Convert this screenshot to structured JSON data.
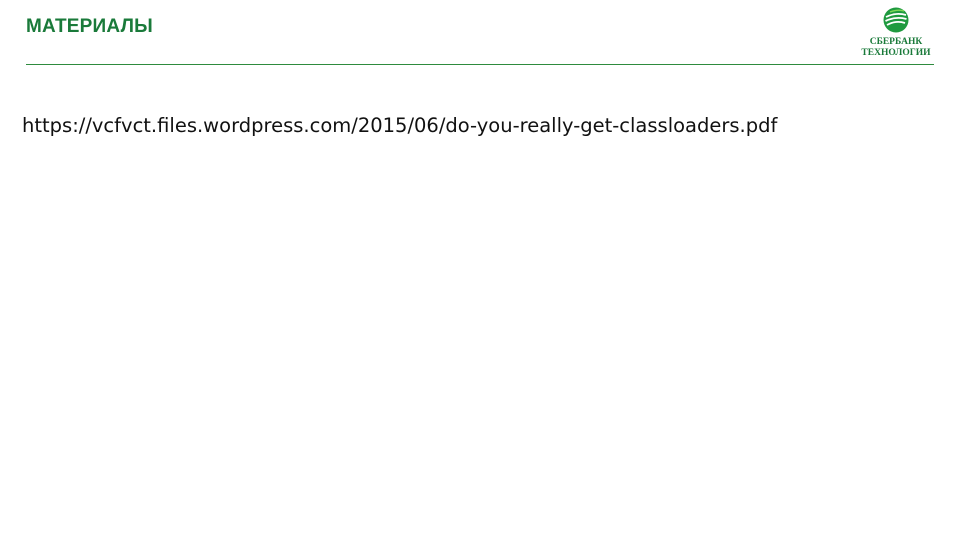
{
  "slide": {
    "title": "МАТЕРИАЛЫ",
    "link_text": "https://vcfvct.files.wordpress.com/2015/06/do-you-really-get-classloaders.pdf"
  },
  "logo": {
    "line1": "СБЕРБАНК",
    "line2": "ТЕХНОЛОГИИ",
    "icon": "sberbank-logo-icon"
  },
  "colors": {
    "accent": "#1a7a3a",
    "rule": "#2e8b3e",
    "text": "#111111",
    "background": "#ffffff"
  }
}
